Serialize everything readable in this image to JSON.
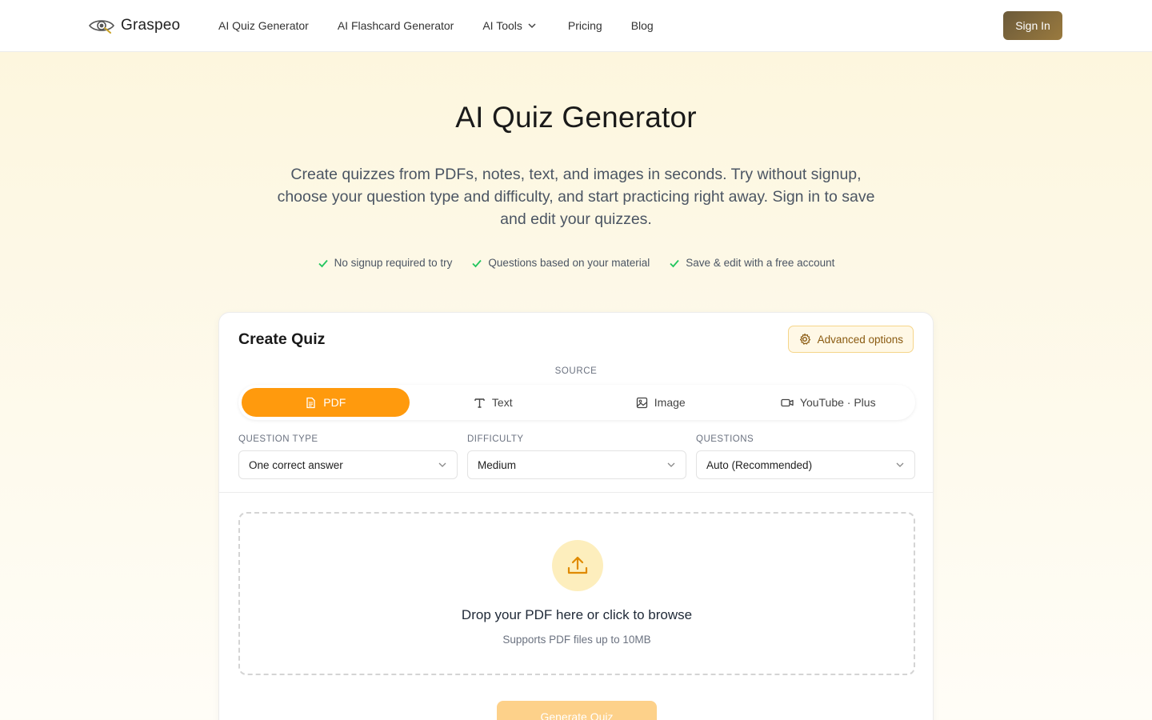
{
  "brand": {
    "name": "Graspeo"
  },
  "nav": {
    "items": [
      "AI Quiz Generator",
      "AI Flashcard Generator",
      "AI Tools",
      "Pricing",
      "Blog"
    ],
    "sign_in": "Sign In"
  },
  "hero": {
    "title": "AI Quiz Generator",
    "subtitle": "Create quizzes from PDFs, notes, text, and images in seconds. Try without signup, choose your question type and difficulty, and start practicing right away. Sign in to save and edit your quizzes.",
    "features": [
      "No signup required to try",
      "Questions based on your material",
      "Save & edit with a free account"
    ]
  },
  "card": {
    "title": "Create Quiz",
    "advanced": "Advanced options",
    "source_label": "SOURCE",
    "tabs": [
      "PDF",
      "Text",
      "Image",
      "YouTube · Plus"
    ],
    "active_tab": "PDF",
    "fields": [
      {
        "label": "QUESTION TYPE",
        "value": "One correct answer"
      },
      {
        "label": "DIFFICULTY",
        "value": "Medium"
      },
      {
        "label": "QUESTIONS",
        "value": "Auto (Recommended)"
      }
    ],
    "dropzone": {
      "title": "Drop your PDF here or click to browse",
      "subtitle": "Supports PDF files up to 10MB"
    },
    "generate": "Generate Quiz"
  },
  "colors": {
    "accent": "#ff9a0d",
    "check": "#22c55e",
    "signin": "#8a6d3b"
  },
  "icons": [
    "eye-logo-icon",
    "chevron-down-icon",
    "check-icon",
    "gear-icon",
    "file-icon",
    "text-icon",
    "image-icon",
    "video-icon",
    "upload-icon"
  ]
}
